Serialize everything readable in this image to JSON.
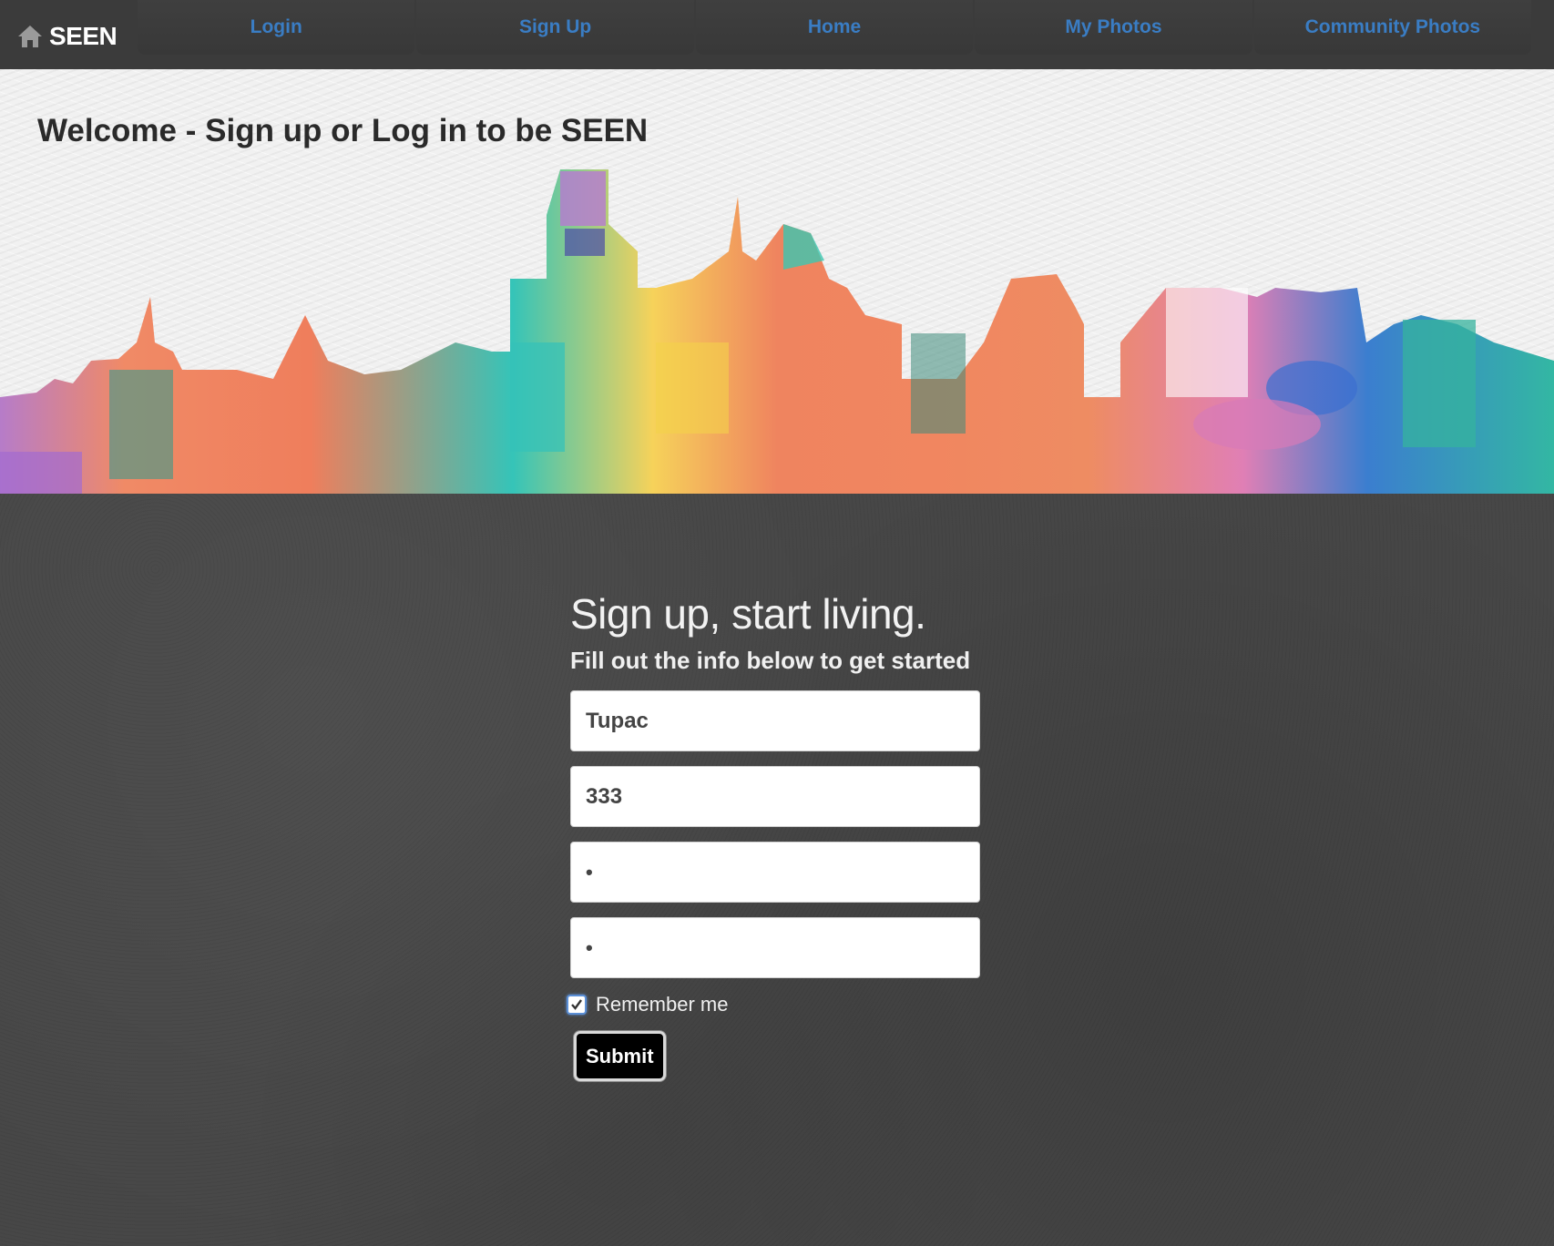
{
  "navbar": {
    "brand": "SEEN",
    "brand_icon": "home-icon",
    "items": [
      {
        "label": "Login"
      },
      {
        "label": "Sign Up"
      },
      {
        "label": "Home"
      },
      {
        "label": "My Photos"
      },
      {
        "label": "Community Photos"
      }
    ],
    "link_color": "#3a7dc4"
  },
  "hero": {
    "title": "Welcome - Sign up or Log in to be SEEN",
    "image": "watercolor-city-skyline"
  },
  "form": {
    "heading": "Sign up, start living.",
    "subheading": "Fill out the info below to get started",
    "fields": [
      {
        "value": "Tupac"
      },
      {
        "value": "333"
      },
      {
        "value": "•"
      },
      {
        "value": "•"
      }
    ],
    "remember_label": "Remember me",
    "remember_checked": true,
    "submit_label": "Submit"
  }
}
